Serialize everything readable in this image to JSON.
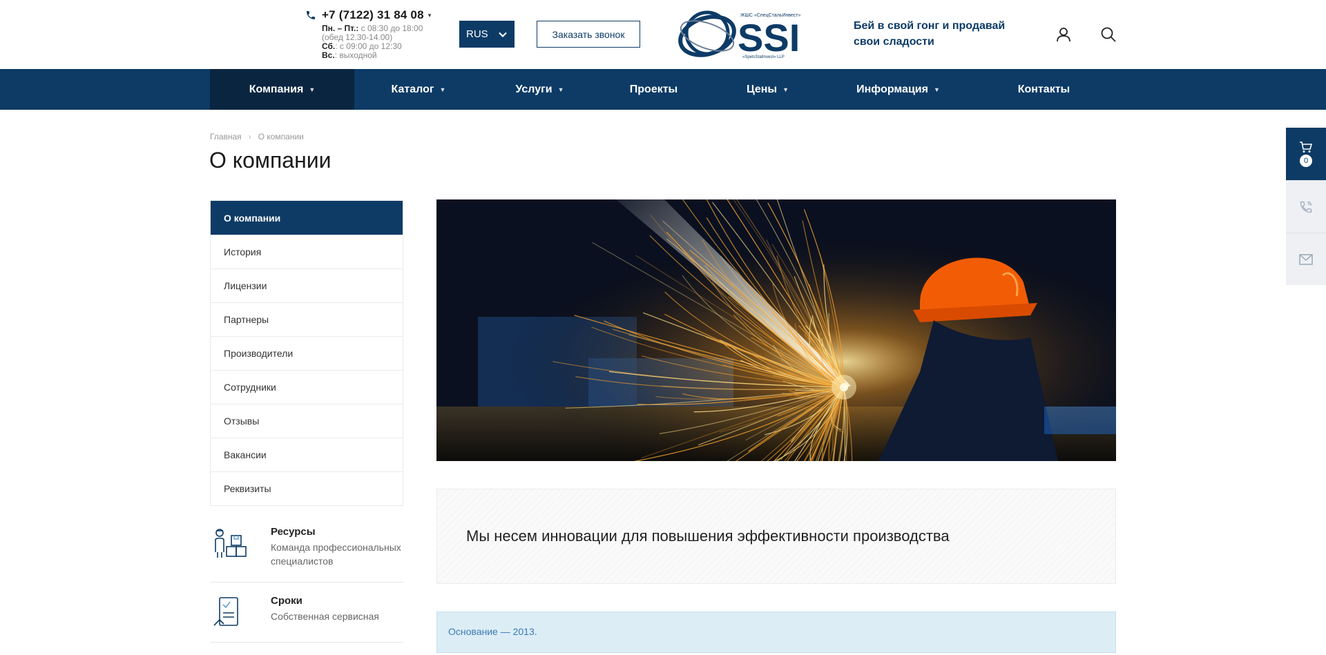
{
  "header": {
    "phone": "+7 (7122) 31 84 08",
    "hours": [
      {
        "label": "Пн. – Пт.:",
        "value": " с 08:30 до 18:00"
      },
      {
        "label": "",
        "value": "(обед 12.30-14.00)"
      },
      {
        "label": "Сб.",
        "value": ": с 09:00 до 12:30"
      },
      {
        "label": "Вс.",
        "value": ": выходной"
      }
    ],
    "language": "RUS",
    "callback_label": "Заказать звонок",
    "logo": {
      "text": "SSI",
      "top_small": "ЖШС «СпецСтальИнвест»",
      "bottom_small": "«SpetsStalInvest» LLP"
    },
    "slogan": "Бей в свой гонг и продавай свои сладости"
  },
  "nav": {
    "items": [
      {
        "label": "Компания",
        "caret": true,
        "active": true
      },
      {
        "label": "Каталог",
        "caret": true
      },
      {
        "label": "Услуги",
        "caret": true
      },
      {
        "label": "Проекты",
        "caret": false
      },
      {
        "label": "Цены",
        "caret": true
      },
      {
        "label": "Информация",
        "caret": true
      },
      {
        "label": "Контакты",
        "caret": false
      }
    ]
  },
  "breadcrumb": {
    "home": "Главная",
    "separator": "›",
    "current": "О компании"
  },
  "page_title": "О компании",
  "sidebar": {
    "items": [
      {
        "label": "О компании",
        "active": true
      },
      {
        "label": "История"
      },
      {
        "label": "Лицензии"
      },
      {
        "label": "Партнеры"
      },
      {
        "label": "Производители"
      },
      {
        "label": "Сотрудники"
      },
      {
        "label": "Отзывы"
      },
      {
        "label": "Вакансии"
      },
      {
        "label": "Реквизиты"
      }
    ]
  },
  "features": [
    {
      "title": "Ресурсы",
      "text": "Команда профессиональных специалистов",
      "icon": "worker-boxes-icon"
    },
    {
      "title": "Сроки",
      "text": "Собственная сервисная",
      "icon": "document-check-icon"
    }
  ],
  "mission": "Мы несем инновации для повышения эффективности производства",
  "info_box": "Основание — 2013.",
  "float_panel": {
    "cart_count": "0",
    "items": [
      "cart-icon",
      "phone-icon",
      "mail-icon"
    ]
  },
  "colors": {
    "brand": "#0d3b66",
    "brand_dark": "#0a2540",
    "info_bg": "#dcedf6",
    "spark": "#ffb12b"
  }
}
